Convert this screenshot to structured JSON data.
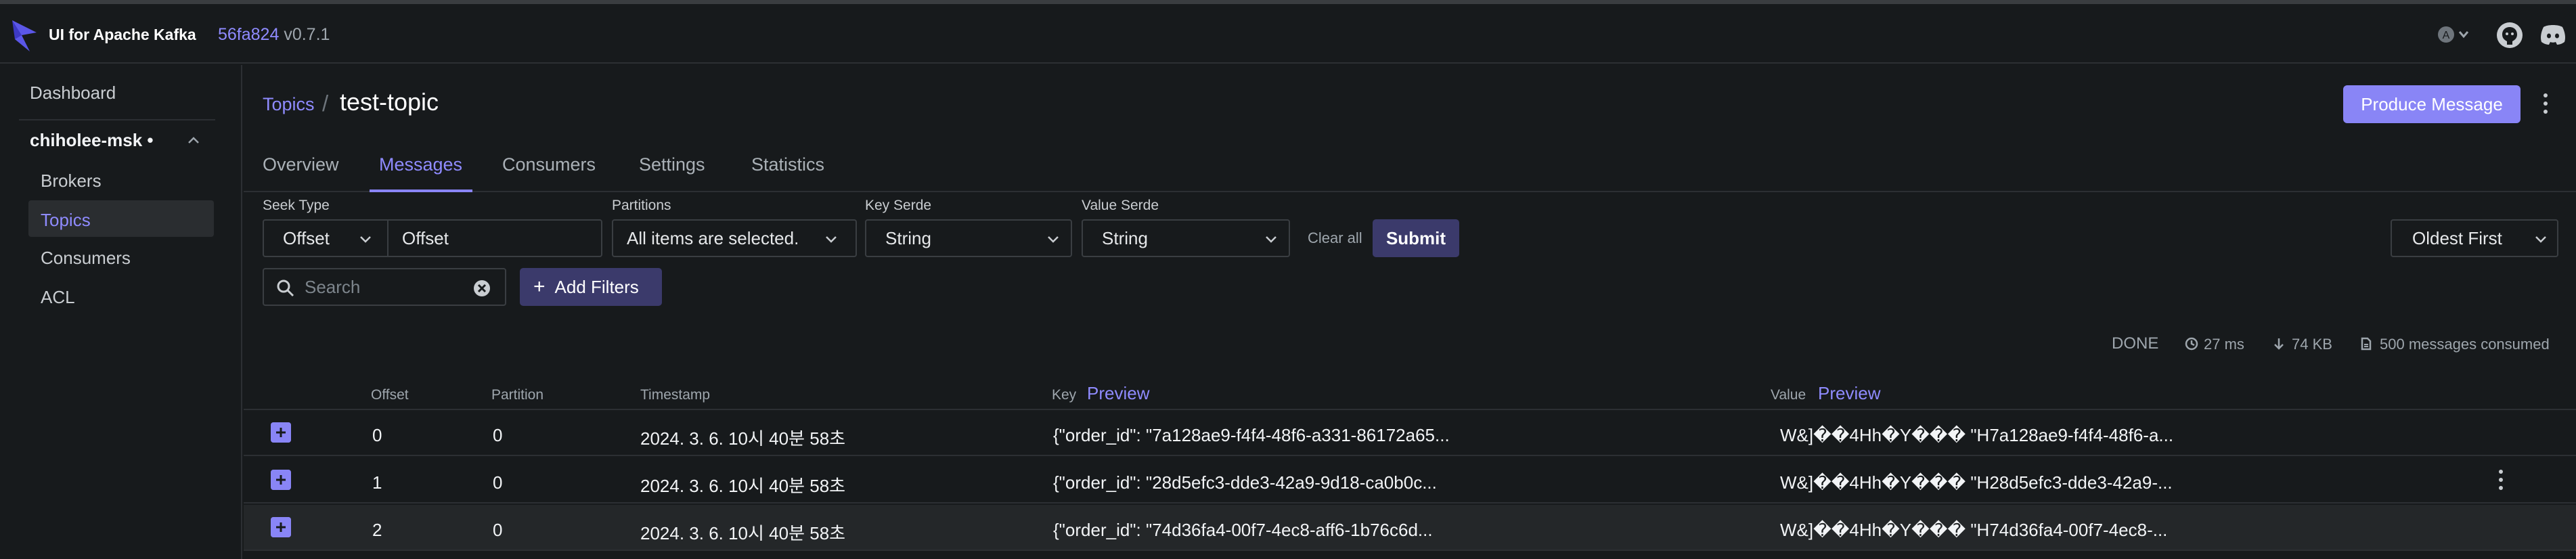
{
  "app": {
    "brand": "UI for Apache Kafka",
    "version_hash": "56fa824",
    "version": "v0.7.1",
    "theme_badge": "A"
  },
  "sidebar": {
    "dashboard": "Dashboard",
    "cluster_name": "chiholee-msk",
    "cluster_dot": "•",
    "items": [
      {
        "label": "Brokers"
      },
      {
        "label": "Topics"
      },
      {
        "label": "Consumers"
      },
      {
        "label": "ACL"
      }
    ]
  },
  "header": {
    "breadcrumb_root": "Topics",
    "breadcrumb_sep": "/",
    "topic_name": "test-topic",
    "produce_label": "Produce Message"
  },
  "tabs": [
    "Overview",
    "Messages",
    "Consumers",
    "Settings",
    "Statistics"
  ],
  "filters": {
    "seek_type_label": "Seek Type",
    "seek_type_value": "Offset",
    "offset_placeholder": "Offset",
    "partitions_label": "Partitions",
    "partitions_value": "All items are selected.",
    "key_serde_label": "Key Serde",
    "key_serde_value": "String",
    "value_serde_label": "Value Serde",
    "value_serde_value": "String",
    "clear_all": "Clear all",
    "submit": "Submit",
    "sort": "Oldest First",
    "search_placeholder": "Search",
    "add_filters": "Add Filters"
  },
  "stats": {
    "status": "DONE",
    "time": "27 ms",
    "size": "74 KB",
    "consumed": "500 messages consumed"
  },
  "table": {
    "headers": {
      "offset": "Offset",
      "partition": "Partition",
      "timestamp": "Timestamp",
      "key": "Key",
      "key_preview": "Preview",
      "value": "Value",
      "value_preview": "Preview"
    },
    "rows": [
      {
        "offset": "0",
        "partition": "0",
        "timestamp": "2024. 3. 6. 10시 40분 58초",
        "key": "{\"order_id\": \"7a128ae9-f4f4-48f6-a331-86172a65...",
        "value": "W&]��4Hh�Y��� \"H7a128ae9-f4f4-48f6-a..."
      },
      {
        "offset": "1",
        "partition": "0",
        "timestamp": "2024. 3. 6. 10시 40분 58초",
        "key": "{\"order_id\": \"28d5efc3-dde3-42a9-9d18-ca0b0c...",
        "value": "W&]��4Hh�Y��� \"H28d5efc3-dde3-42a9-..."
      },
      {
        "offset": "2",
        "partition": "0",
        "timestamp": "2024. 3. 6. 10시 40분 58초",
        "key": "{\"order_id\": \"74d36fa4-00f7-4ec8-aff6-1b76c6d...",
        "value": "W&]��4Hh�Y��� \"H74d36fa4-00f7-4ec8-..."
      }
    ]
  },
  "colors": {
    "accent": "#8985f6",
    "accent_dark": "#3b3a6b",
    "background": "#171a1c"
  }
}
